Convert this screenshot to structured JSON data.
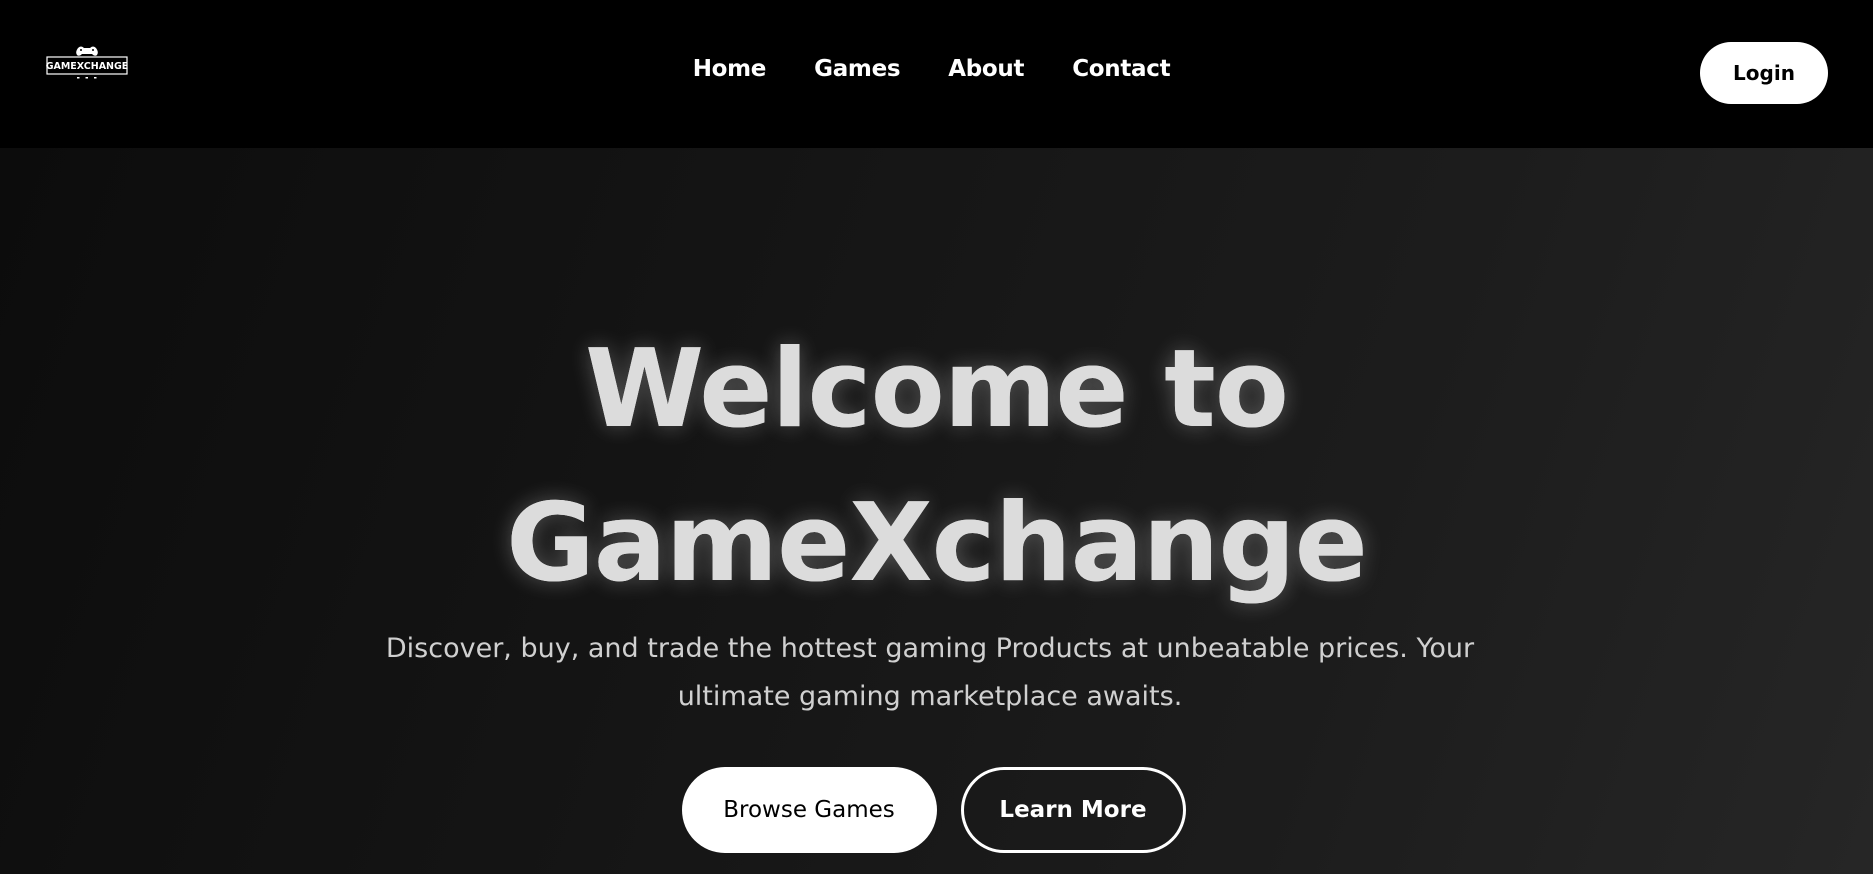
{
  "header": {
    "logo": {
      "text": "GAMEXCHANGE",
      "icon": "gamepad-icon"
    },
    "nav": [
      {
        "label": "Home"
      },
      {
        "label": "Games"
      },
      {
        "label": "About"
      },
      {
        "label": "Contact"
      }
    ],
    "login_label": "Login"
  },
  "hero": {
    "title_line1": "Welcome to",
    "title_line2": "GameXchange",
    "subtitle": "Discover, buy, and trade the hottest gaming Products at unbeatable prices. Your ultimate gaming marketplace awaits.",
    "primary_button": "Browse Games",
    "secondary_button": "Learn More"
  },
  "colors": {
    "background": "#000000",
    "hero_gradient_start": "#0c0c0c",
    "hero_gradient_end": "#262626",
    "accent": "#ffffff"
  }
}
